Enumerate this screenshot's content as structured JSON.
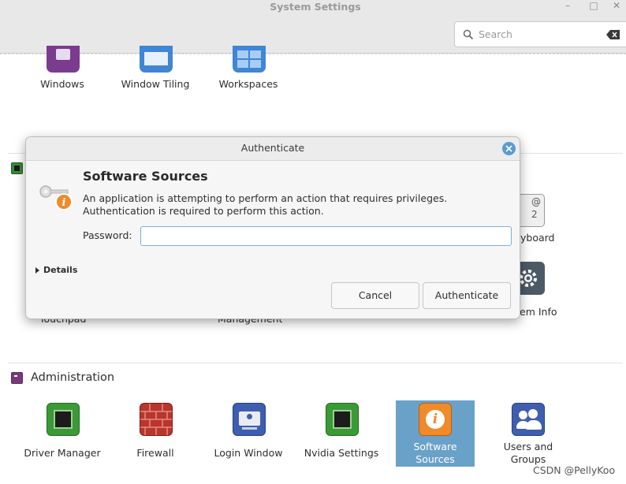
{
  "window": {
    "title": "System Settings"
  },
  "search": {
    "placeholder": "Search"
  },
  "top_row": [
    {
      "label": "Windows",
      "icon": "windows-icon"
    },
    {
      "label": "Window Tiling",
      "icon": "window-tiling-icon"
    },
    {
      "label": "Workspaces",
      "icon": "workspaces-icon"
    }
  ],
  "hardware_partial": {
    "touchpad": "Touchpad",
    "management": "Management",
    "keyboard": "yboard",
    "system_info": "em Info"
  },
  "administration": {
    "title": "Administration",
    "items": [
      {
        "label": "Driver Manager",
        "icon": "chip-icon"
      },
      {
        "label": "Firewall",
        "icon": "firewall-icon"
      },
      {
        "label": "Login Window",
        "icon": "login-window-icon"
      },
      {
        "label": "Nvidia Settings",
        "icon": "chip-icon"
      },
      {
        "label_line1": "Software",
        "label_line2": "Sources",
        "icon": "info-icon",
        "selected": true
      },
      {
        "label_line1": "Users and",
        "label_line2": "Groups",
        "icon": "users-icon"
      }
    ]
  },
  "dialog": {
    "title": "Authenticate",
    "heading": "Software Sources",
    "message": "An application is attempting to perform an action that requires privileges. Authentication is required to perform this action.",
    "password_label": "Password:",
    "password_value": "",
    "details_label": "Details",
    "cancel_label": "Cancel",
    "authenticate_label": "Authenticate"
  },
  "watermark": "CSDN @PellyKoo",
  "colors": {
    "selection": "#6aa1c9",
    "accent": "#5b9bd0",
    "admin": "#7a3a7a"
  }
}
